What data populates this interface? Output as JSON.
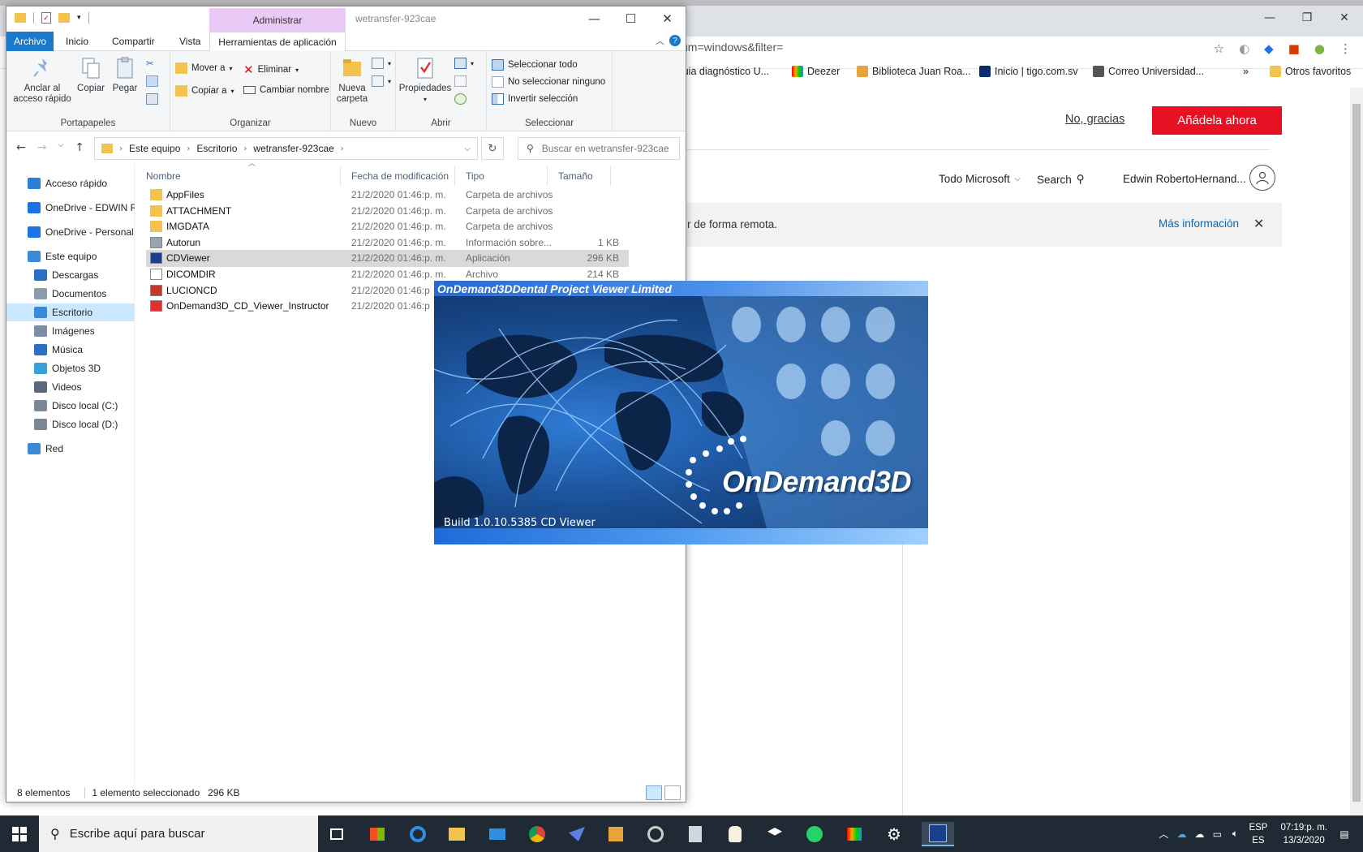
{
  "browser": {
    "url_fragment": "um=windows&filter=",
    "bookmarks": [
      "Guia diagnóstico U...",
      "Deezer",
      "Biblioteca Juan Roa...",
      "Inicio | tigo.com.sv",
      "Correo Universidad...",
      "»",
      "Otros favoritos"
    ],
    "banner": {
      "no_thanks": "No, gracias",
      "add_now": "Añádela ahora"
    },
    "nav": {
      "all_microsoft": "Todo Microsoft",
      "search": "Search",
      "user": "Edwin RobertoHernand..."
    },
    "notice": {
      "text": "r de forma remota.",
      "more_info": "Más información"
    }
  },
  "explorer": {
    "window_title": "wetransfer-923cae",
    "context_tab": "Administrar",
    "ribbon_tabs": [
      "Archivo",
      "Inicio",
      "Compartir",
      "Vista",
      "Herramientas de aplicación"
    ],
    "groups": {
      "portapapeles": {
        "label": "Portapapeles",
        "pin": "Anclar al acceso rápido",
        "copy": "Copiar",
        "paste": "Pegar"
      },
      "organizar": {
        "label": "Organizar",
        "move": "Mover a",
        "copy_to": "Copiar a",
        "delete": "Eliminar",
        "rename": "Cambiar nombre"
      },
      "nuevo": {
        "label": "Nuevo",
        "new_folder": "Nueva carpeta"
      },
      "abrir": {
        "label": "Abrir",
        "properties": "Propiedades"
      },
      "seleccionar": {
        "label": "Seleccionar",
        "select_all": "Seleccionar todo",
        "select_none": "No seleccionar ninguno",
        "invert": "Invertir selección"
      }
    },
    "breadcrumb": [
      "Este equipo",
      "Escritorio",
      "wetransfer-923cae"
    ],
    "search_placeholder": "Buscar en wetransfer-923cae",
    "nav_pane": [
      {
        "label": "Acceso rápido",
        "color": "#2a7fd4"
      },
      {
        "label": "OneDrive - EDWIN RO",
        "color": "#1a73e8"
      },
      {
        "label": "OneDrive - Personal",
        "color": "#1a73e8"
      },
      {
        "label": "Este equipo",
        "color": "#3b8ad9"
      },
      {
        "label": "Descargas",
        "color": "#2b6fc4"
      },
      {
        "label": "Documentos",
        "color": "#8a9bb0"
      },
      {
        "label": "Escritorio",
        "color": "#3b8ad9"
      },
      {
        "label": "Imágenes",
        "color": "#7a8ea4"
      },
      {
        "label": "Música",
        "color": "#2b6fc4"
      },
      {
        "label": "Objetos 3D",
        "color": "#3aa0d8"
      },
      {
        "label": "Videos",
        "color": "#5a6a7a"
      },
      {
        "label": "Disco local (C:)",
        "color": "#7a8796"
      },
      {
        "label": "Disco local (D:)",
        "color": "#7a8796"
      },
      {
        "label": "Red",
        "color": "#3b8ad9"
      }
    ],
    "columns": [
      "Nombre",
      "Fecha de modificación",
      "Tipo",
      "Tamaño"
    ],
    "files": [
      {
        "name": "AppFiles",
        "date": "21/2/2020 01:46:p. m.",
        "type": "Carpeta de archivos",
        "size": "",
        "icon": "#f3c44d"
      },
      {
        "name": "ATTACHMENT",
        "date": "21/2/2020 01:46:p. m.",
        "type": "Carpeta de archivos",
        "size": "",
        "icon": "#f3c44d"
      },
      {
        "name": "IMGDATA",
        "date": "21/2/2020 01:46:p. m.",
        "type": "Carpeta de archivos",
        "size": "",
        "icon": "#f3c44d"
      },
      {
        "name": "Autorun",
        "date": "21/2/2020 01:46:p. m.",
        "type": "Información sobre...",
        "size": "1 KB",
        "icon": "#9aa4ae"
      },
      {
        "name": "CDViewer",
        "date": "21/2/2020 01:46:p. m.",
        "type": "Aplicación",
        "size": "296 KB",
        "icon": "#1b3f8c"
      },
      {
        "name": "DICOMDIR",
        "date": "21/2/2020 01:46:p. m.",
        "type": "Archivo",
        "size": "214 KB",
        "icon": "#ffffff"
      },
      {
        "name": "LUCIONCD",
        "date": "21/2/2020 01:46:p",
        "type": "",
        "size": "",
        "icon": "#c0392b"
      },
      {
        "name": "OnDemand3D_CD_Viewer_Instructor",
        "date": "21/2/2020 01:46:p",
        "type": "",
        "size": "",
        "icon": "#e03030"
      }
    ],
    "status": {
      "count": "8 elementos",
      "selection": "1 elemento seleccionado   296 KB"
    }
  },
  "splash": {
    "title": "OnDemand3DDental Project Viewer Limited",
    "logo": "OnDemand3D",
    "build": "Build 1.0.10.5385 CD Viewer"
  },
  "taskbar": {
    "search_placeholder": "Escribe aquí para buscar",
    "lang_top": "ESP",
    "lang_bottom": "ES",
    "time": "07:19:p. m.",
    "date": "13/3/2020"
  }
}
